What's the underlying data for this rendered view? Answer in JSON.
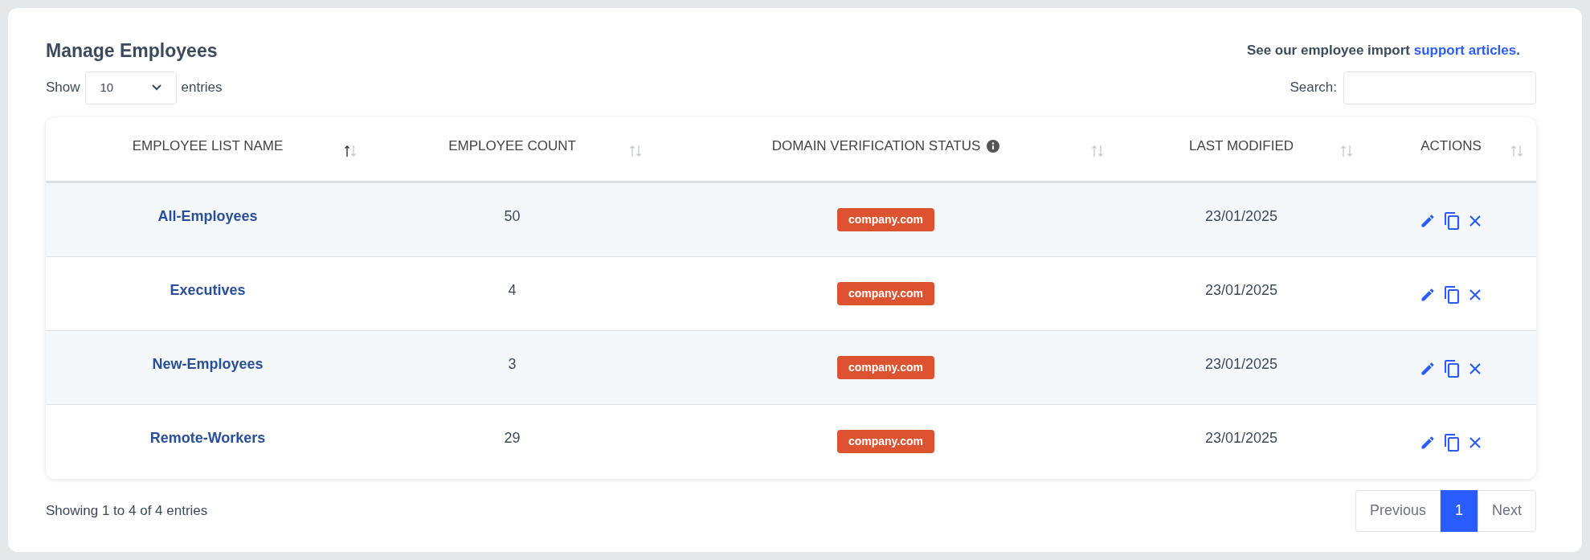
{
  "title": "Manage Employees",
  "support_note": {
    "text": "See our employee import ",
    "link": "support articles",
    "end": "."
  },
  "length_control": {
    "before": "Show",
    "value": "10",
    "after": "entries"
  },
  "search": {
    "label": "Search:"
  },
  "table": {
    "columns": [
      {
        "label": "EMPLOYEE LIST NAME",
        "sorted": true,
        "info": false
      },
      {
        "label": "EMPLOYEE COUNT",
        "sorted": false,
        "info": false
      },
      {
        "label": "DOMAIN VERIFICATION STATUS",
        "sorted": false,
        "info": true
      },
      {
        "label": "LAST MODIFIED",
        "sorted": false,
        "info": false
      },
      {
        "label": "ACTIONS",
        "sorted": false,
        "info": false
      }
    ],
    "rows": [
      {
        "name": "All-Employees",
        "count": "50",
        "domain": "company.com",
        "modified": "23/01/2025"
      },
      {
        "name": "Executives",
        "count": "4",
        "domain": "company.com",
        "modified": "23/01/2025"
      },
      {
        "name": "New-Employees",
        "count": "3",
        "domain": "company.com",
        "modified": "23/01/2025"
      },
      {
        "name": "Remote-Workers",
        "count": "29",
        "domain": "company.com",
        "modified": "23/01/2025"
      }
    ]
  },
  "info_text": "Showing 1 to 4 of 4 entries",
  "pagination": [
    {
      "label": "Previous",
      "selected": false
    },
    {
      "label": "1",
      "selected": true
    },
    {
      "label": "Next",
      "selected": false
    }
  ]
}
